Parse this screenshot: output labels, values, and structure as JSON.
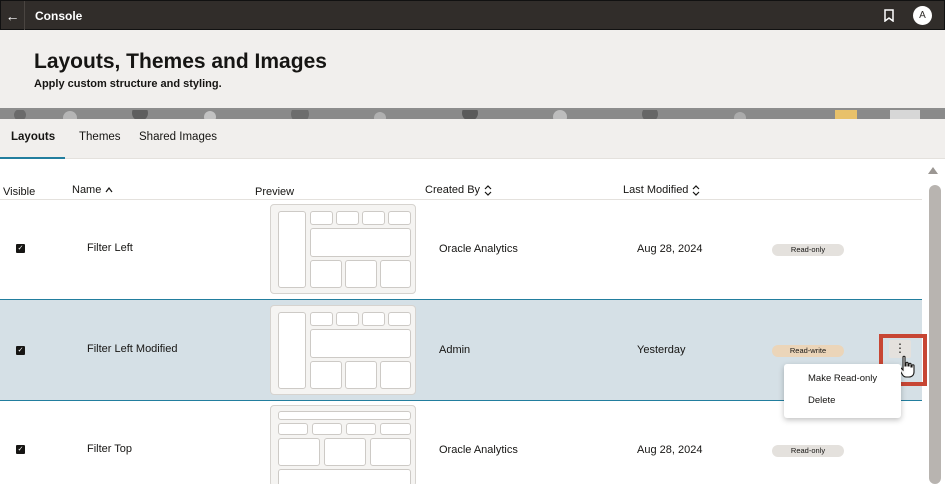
{
  "topbar": {
    "title": "Console",
    "avatar_initial": "A"
  },
  "header": {
    "title": "Layouts, Themes and Images",
    "subtitle": "Apply custom structure and styling."
  },
  "tabs": [
    {
      "label": "Layouts",
      "active": true
    },
    {
      "label": "Themes",
      "active": false
    },
    {
      "label": "Shared Images",
      "active": false
    }
  ],
  "columns": {
    "visible": "Visible",
    "name": "Name",
    "preview": "Preview",
    "created_by": "Created By",
    "last_modified": "Last Modified"
  },
  "rows": [
    {
      "visible": true,
      "name": "Filter Left",
      "created_by": "Oracle Analytics",
      "last_modified": "Aug 28, 2024",
      "status": "Read-only"
    },
    {
      "visible": true,
      "name": "Filter Left Modified",
      "created_by": "Admin",
      "last_modified": "Yesterday",
      "status": "Read-write"
    },
    {
      "visible": true,
      "name": "Filter Top",
      "created_by": "Oracle Analytics",
      "last_modified": "Aug 28, 2024",
      "status": "Read-only"
    }
  ],
  "context_menu": {
    "items": [
      "Make Read-only",
      "Delete"
    ]
  },
  "icons": {
    "back": "back-arrow-icon",
    "bookmark": "bookmark-icon",
    "more": "more-vertical-icon",
    "sort": "sort-icon"
  },
  "colors": {
    "topbar": "#312d2a",
    "accent": "#227e9e",
    "highlight": "#c74634",
    "selected_row": "#d5e0e6"
  }
}
